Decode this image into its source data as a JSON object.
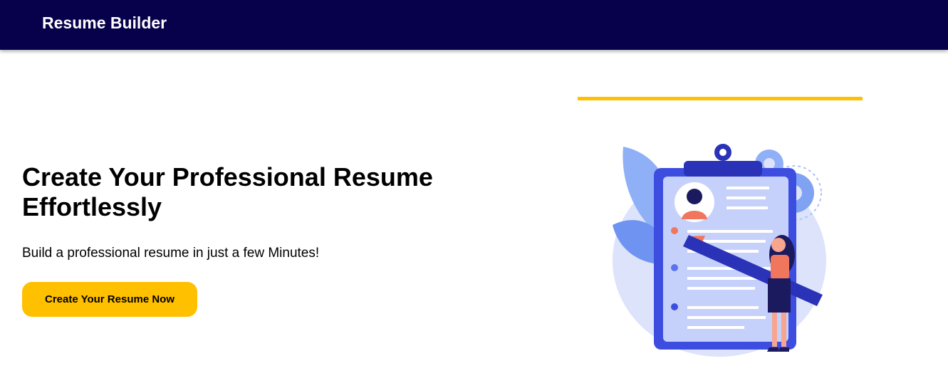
{
  "header": {
    "brand": "Resume Builder"
  },
  "hero": {
    "title": "Create Your Professional Resume Effortlessly",
    "subtitle": "Build a professional resume in just a few Minutes!",
    "cta_label": "Create Your Resume Now"
  },
  "illustration": {
    "name": "resume-clipboard-illustration",
    "icons": [
      "clipboard-icon",
      "gear-icon",
      "pencil-icon",
      "leaf-icon"
    ]
  },
  "colors": {
    "navbar_bg": "#07004a",
    "accent": "#ffc000",
    "illustration_blue": "#3d4de0",
    "illustration_light": "#dce3fb"
  }
}
